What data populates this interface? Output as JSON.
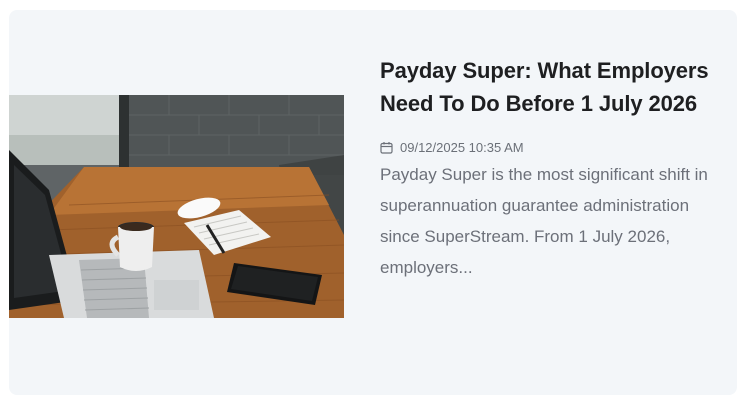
{
  "post": {
    "title": "Payday Super: What Employers Need To Do Before 1 July 2026",
    "date": "09/12/2025 10:35 AM",
    "excerpt": "Payday Super is the most significant shift in superannuation guarantee administration since SuperStream. From 1 July 2026, employers...",
    "date_icon": "calendar-icon",
    "thumbnail": "desk-laptop-coffee-photo"
  }
}
